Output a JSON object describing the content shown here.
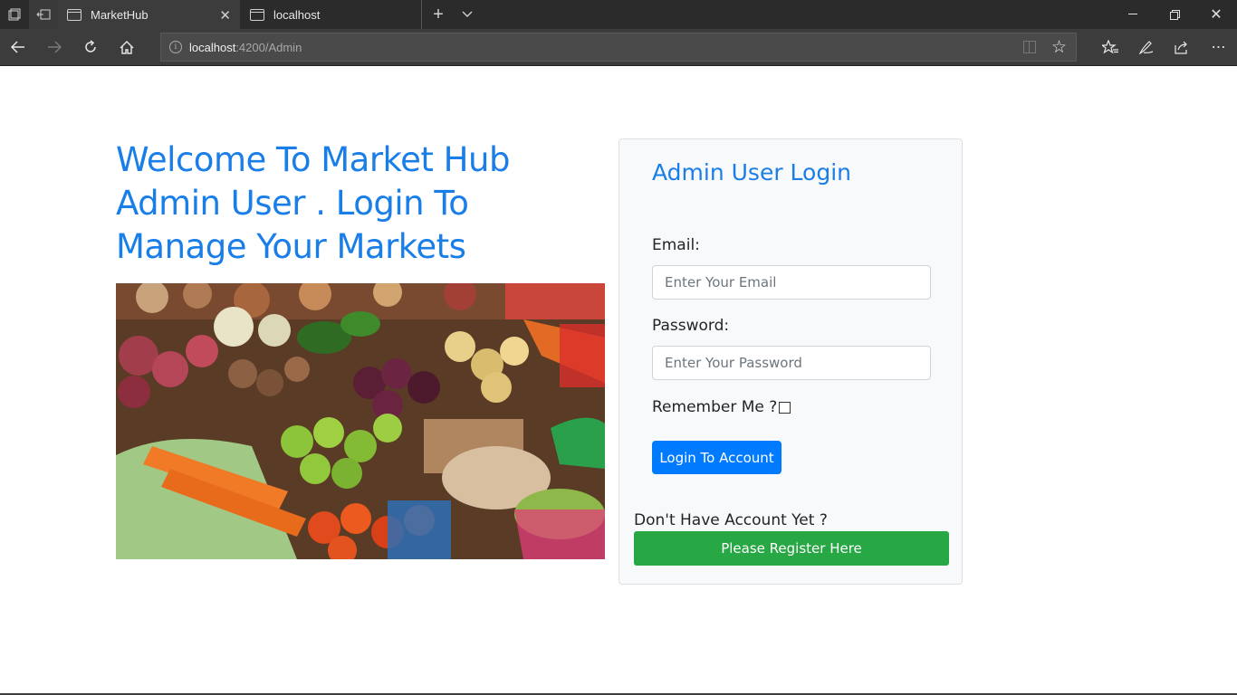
{
  "browser": {
    "tabs": [
      {
        "title": "MarketHub",
        "active": true
      },
      {
        "title": "localhost",
        "active": false
      }
    ],
    "address": {
      "host": "localhost",
      "path": ":4200/Admin"
    }
  },
  "page": {
    "welcome_text": "Welcome To Market Hub Admin User . Login To Manage Your Markets",
    "image_icon": "market-produce-photo"
  },
  "login": {
    "title": "Admin User Login",
    "email_label": "Email:",
    "email_placeholder": "Enter Your Email",
    "password_label": "Password:",
    "password_placeholder": "Enter Your Password",
    "remember_label": "Remember Me ?",
    "login_button": "Login To Account",
    "no_account_text": "Don't Have Account Yet ?",
    "register_button": "Please Register Here"
  },
  "colors": {
    "brand_blue": "#1a7ee8",
    "primary_button": "#007bff",
    "success_button": "#28a745",
    "chrome_dark": "#2b2b2b"
  }
}
